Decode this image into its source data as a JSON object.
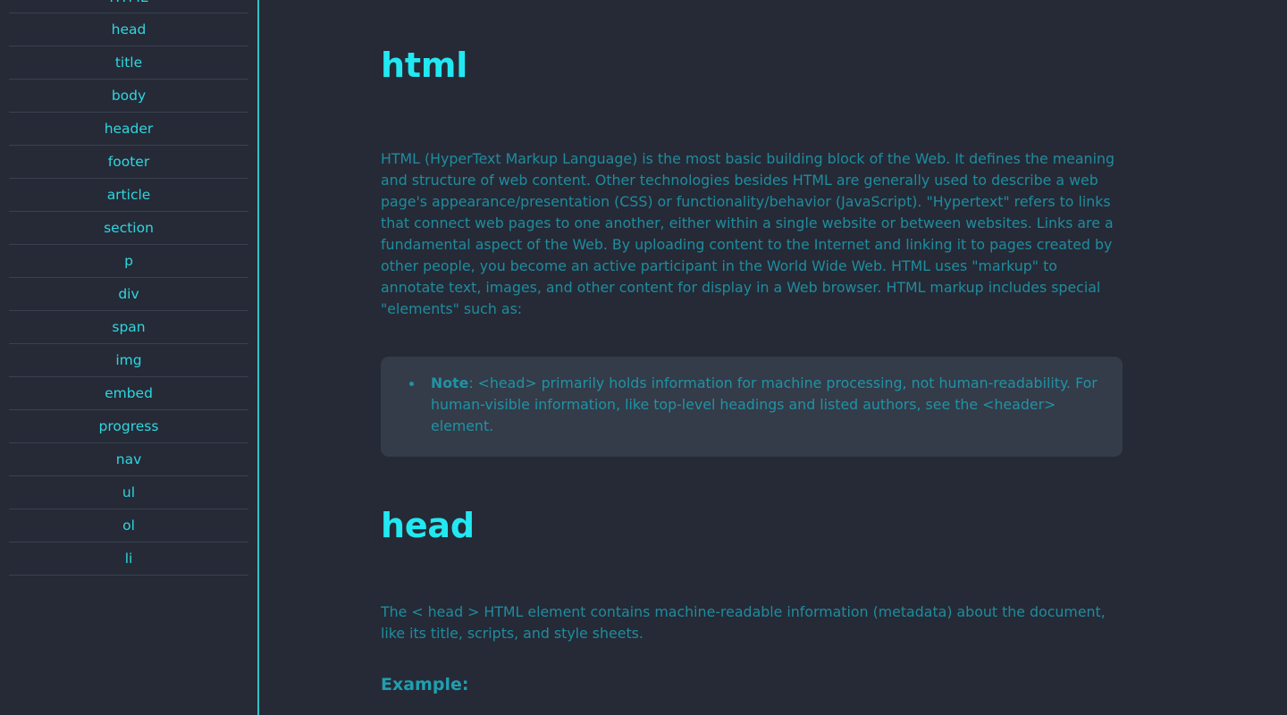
{
  "theme": {
    "background": "#252a36",
    "sidebar_border": "#2ec4c4",
    "sidebar_link": "#2ed7e0",
    "sidebar_divider": "#394150",
    "heading_accent": "#22e8f2",
    "body_text": "#1f8c9e",
    "note_background": "#343b49",
    "note_text": "#1f93a4"
  },
  "sidebar": {
    "name": "html-elements-nav",
    "items": [
      {
        "label": "HTML",
        "name": "sidebar-item-html"
      },
      {
        "label": "head",
        "name": "sidebar-item-head"
      },
      {
        "label": "title",
        "name": "sidebar-item-title"
      },
      {
        "label": "body",
        "name": "sidebar-item-body"
      },
      {
        "label": "header",
        "name": "sidebar-item-header"
      },
      {
        "label": "footer",
        "name": "sidebar-item-footer"
      },
      {
        "label": "article",
        "name": "sidebar-item-article"
      },
      {
        "label": "section",
        "name": "sidebar-item-section"
      },
      {
        "label": "p",
        "name": "sidebar-item-p"
      },
      {
        "label": "div",
        "name": "sidebar-item-div"
      },
      {
        "label": "span",
        "name": "sidebar-item-span"
      },
      {
        "label": "img",
        "name": "sidebar-item-img"
      },
      {
        "label": "embed",
        "name": "sidebar-item-embed"
      },
      {
        "label": "progress",
        "name": "sidebar-item-progress"
      },
      {
        "label": "nav",
        "name": "sidebar-item-nav"
      },
      {
        "label": "ul",
        "name": "sidebar-item-ul"
      },
      {
        "label": "ol",
        "name": "sidebar-item-ol"
      },
      {
        "label": "li",
        "name": "sidebar-item-li"
      }
    ]
  },
  "main": {
    "html_section": {
      "title": "html",
      "paragraph": "HTML (HyperText Markup Language) is the most basic building block of the Web. It defines the meaning and structure of web content. Other technologies besides HTML are generally used to describe a web page's appearance/presentation (CSS) or functionality/behavior (JavaScript). \"Hypertext\" refers to links that connect web pages to one another, either within a single website or between websites. Links are a fundamental aspect of the Web. By uploading content to the Internet and linking it to pages created by other people, you become an active participant in the World Wide Web. HTML uses \"markup\" to annotate text, images, and other content for display in a Web browser. HTML markup includes special \"elements\" such as:",
      "note": {
        "label": "Note",
        "text": ": <head> primarily holds information for machine processing, not human-readability. For human-visible information, like top-level headings and listed authors, see the <header> element."
      }
    },
    "head_section": {
      "title": "head",
      "paragraph": "The < head > HTML element contains machine-readable information (metadata) about the document, like its title, scripts, and style sheets.",
      "example_heading": "Example:"
    }
  }
}
